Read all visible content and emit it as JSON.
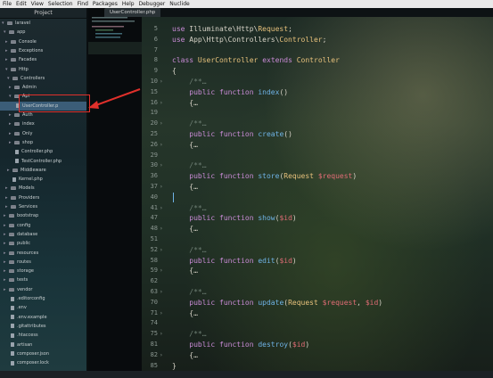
{
  "menu": [
    "File",
    "Edit",
    "View",
    "Selection",
    "Find",
    "Packages",
    "Help",
    "Debugger",
    "Nuclide"
  ],
  "sidebar": {
    "title": "Project",
    "items": [
      {
        "label": "laravel",
        "type": "folder"
      },
      {
        "label": "app",
        "type": "folder"
      },
      {
        "label": "Console",
        "type": "folder"
      },
      {
        "label": "Exceptions",
        "type": "folder"
      },
      {
        "label": "Facades",
        "type": "folder"
      },
      {
        "label": "Http",
        "type": "folder"
      },
      {
        "label": "Controllers",
        "type": "folder"
      },
      {
        "label": "Admin",
        "type": "folder"
      },
      {
        "label": "Api",
        "type": "folder"
      },
      {
        "label": "UserController.p",
        "type": "file"
      },
      {
        "label": "Auth",
        "type": "folder"
      },
      {
        "label": "index",
        "type": "folder"
      },
      {
        "label": "Only",
        "type": "folder"
      },
      {
        "label": "shop",
        "type": "folder"
      },
      {
        "label": "Controller.php",
        "type": "file"
      },
      {
        "label": "TestController.php",
        "type": "file"
      },
      {
        "label": "Middleware",
        "type": "folder"
      },
      {
        "label": "Kernel.php",
        "type": "file"
      },
      {
        "label": "Models",
        "type": "folder"
      },
      {
        "label": "Providers",
        "type": "folder"
      },
      {
        "label": "Services",
        "type": "folder"
      },
      {
        "label": "bootstrap",
        "type": "folder"
      },
      {
        "label": "config",
        "type": "folder"
      },
      {
        "label": "database",
        "type": "folder"
      },
      {
        "label": "public",
        "type": "folder"
      },
      {
        "label": "resources",
        "type": "folder"
      },
      {
        "label": "routes",
        "type": "folder"
      },
      {
        "label": "storage",
        "type": "folder"
      },
      {
        "label": "tests",
        "type": "folder"
      },
      {
        "label": "vendor",
        "type": "folder"
      },
      {
        "label": ".editorconfig",
        "type": "file"
      },
      {
        "label": ".env",
        "type": "file"
      },
      {
        "label": ".env.example",
        "type": "file"
      },
      {
        "label": ".gitattributes",
        "type": "file"
      },
      {
        "label": ".htaccess",
        "type": "file"
      },
      {
        "label": "artisan",
        "type": "file"
      },
      {
        "label": "composer.json",
        "type": "file"
      },
      {
        "label": "composer.lock",
        "type": "file"
      }
    ]
  },
  "tab": {
    "label": "UserController.php"
  },
  "editor": {
    "lines": [
      {
        "n": "5",
        "t": "use Illuminate\\Http\\Request;"
      },
      {
        "n": "6",
        "t": "use App\\Http\\Controllers\\Controller;"
      },
      {
        "n": "7",
        "t": ""
      },
      {
        "n": "8",
        "t": "class UserController extends Controller"
      },
      {
        "n": "9",
        "t": "{"
      },
      {
        "n": "10",
        "t": "    /**…"
      },
      {
        "n": "15",
        "t": "    public function index()"
      },
      {
        "n": "16",
        "t": "    {…"
      },
      {
        "n": "19",
        "t": ""
      },
      {
        "n": "20",
        "t": "    /**…"
      },
      {
        "n": "25",
        "t": "    public function create()"
      },
      {
        "n": "26",
        "t": "    {…"
      },
      {
        "n": "29",
        "t": ""
      },
      {
        "n": "30",
        "t": "    /**…"
      },
      {
        "n": "36",
        "t": "    public function store(Request $request)"
      },
      {
        "n": "37",
        "t": "    {…"
      },
      {
        "n": "40",
        "t": ""
      },
      {
        "n": "41",
        "t": "    /**…"
      },
      {
        "n": "47",
        "t": "    public function show($id)"
      },
      {
        "n": "48",
        "t": "    {…"
      },
      {
        "n": "51",
        "t": ""
      },
      {
        "n": "52",
        "t": "    /**…"
      },
      {
        "n": "58",
        "t": "    public function edit($id)"
      },
      {
        "n": "59",
        "t": "    {…"
      },
      {
        "n": "62",
        "t": ""
      },
      {
        "n": "63",
        "t": "    /**…"
      },
      {
        "n": "70",
        "t": "    public function update(Request $request, $id)"
      },
      {
        "n": "71",
        "t": "    {…"
      },
      {
        "n": "74",
        "t": ""
      },
      {
        "n": "75",
        "t": "    /**…"
      },
      {
        "n": "81",
        "t": "    public function destroy($id)"
      },
      {
        "n": "82",
        "t": "    {…"
      },
      {
        "n": "85",
        "t": "}"
      }
    ]
  },
  "colors": {
    "annotation": "#e0302b",
    "selection": "#3b5d78"
  }
}
